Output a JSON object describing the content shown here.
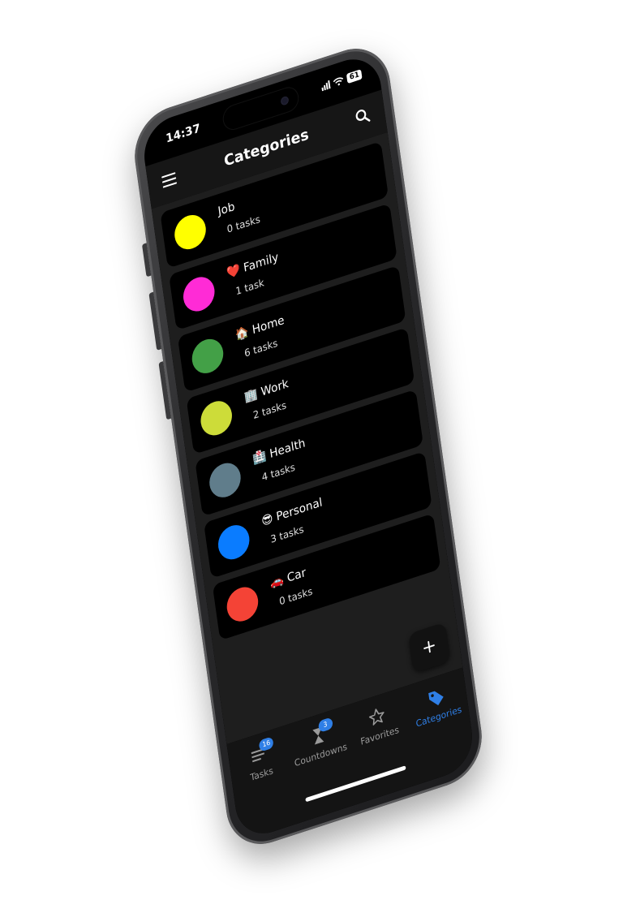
{
  "status_bar": {
    "time": "14:37",
    "battery": "61"
  },
  "app_bar": {
    "title": "Categories"
  },
  "categories": [
    {
      "emoji": "",
      "name": "Job",
      "count": "0 tasks",
      "color": "#ffff00"
    },
    {
      "emoji": "❤️",
      "name": "Family",
      "count": "1 task",
      "color": "#ff2bd6"
    },
    {
      "emoji": "🏠",
      "name": "Home",
      "count": "6 tasks",
      "color": "#43a047"
    },
    {
      "emoji": "🏢",
      "name": "Work",
      "count": "2 tasks",
      "color": "#cddc39"
    },
    {
      "emoji": "🏥",
      "name": "Health",
      "count": "4 tasks",
      "color": "#607d8b"
    },
    {
      "emoji": "😎",
      "name": "Personal",
      "count": "3 tasks",
      "color": "#0a7cff"
    },
    {
      "emoji": "🚗",
      "name": "Car",
      "count": "0 tasks",
      "color": "#f44336"
    }
  ],
  "fab": {
    "label": "+"
  },
  "bottom_nav": {
    "items": [
      {
        "label": "Tasks",
        "badge": "16",
        "icon": "task-list-icon",
        "active": false
      },
      {
        "label": "Countdowns",
        "badge": "3",
        "icon": "hourglass-icon",
        "active": false
      },
      {
        "label": "Favorites",
        "badge": "",
        "icon": "star-icon",
        "active": false
      },
      {
        "label": "Categories",
        "badge": "",
        "icon": "tag-icon",
        "active": true
      }
    ]
  },
  "colors": {
    "accent": "#2f7fe6",
    "background": "#000000",
    "list_background": "#1e1e1e"
  }
}
